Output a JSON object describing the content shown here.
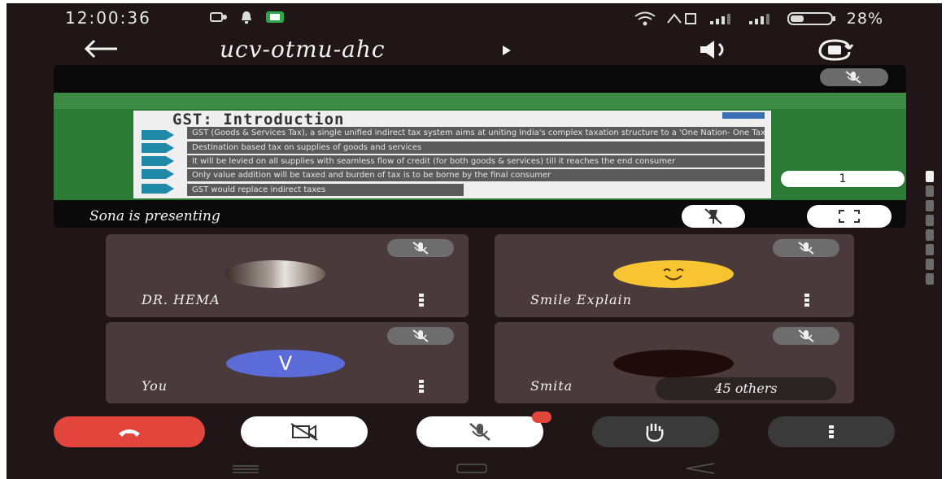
{
  "status": {
    "time": "12:00:36",
    "battery": "28%"
  },
  "meeting": {
    "code": "ucv-otmu-ahc"
  },
  "presentation": {
    "presenter_label": "Sona is presenting",
    "slide_page": "1",
    "slide": {
      "title": "GST: Introduction",
      "bullets": [
        "GST (Goods & Services Tax), a single unified indirect tax system aims at uniting India's complex taxation structure to a 'One Nation- One Tax' regime",
        "Destination based tax on supplies of goods and services",
        "It will be levied on all supplies with seamless flow of credit (for both goods & services) till it reaches the end consumer",
        "Only value addition will be taxed and burden of tax is to be borne by the final consumer",
        "GST would replace indirect taxes"
      ]
    }
  },
  "participants": [
    {
      "name": "DR. HEMA"
    },
    {
      "name": "Smile Explain"
    },
    {
      "name": "You",
      "initial": "V"
    },
    {
      "name": "Smita",
      "others": "45 others"
    }
  ],
  "colors": {
    "background": "#201617",
    "tile": "#4a3a3b",
    "end_call": "#e2453c",
    "avatar_you": "#5b6cd8",
    "emoji": "#f7c531",
    "notify_badge": "#e2453c"
  },
  "icons": {
    "back": "arrow-left-icon",
    "play": "play-icon",
    "speaker": "speaker-icon",
    "camera_switch": "camera-switch-icon",
    "pin": "pin-off-icon",
    "fullscreen": "fullscreen-icon",
    "mute": "mic-off-icon",
    "more": "more-vertical-icon",
    "hangup": "hangup-icon",
    "video_off": "video-off-icon",
    "hand": "raise-hand-icon"
  }
}
